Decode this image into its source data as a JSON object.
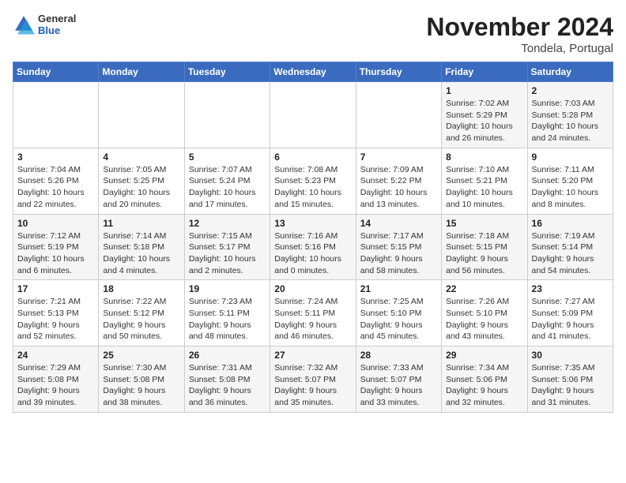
{
  "logo": {
    "general": "General",
    "blue": "Blue"
  },
  "title": "November 2024",
  "subtitle": "Tondela, Portugal",
  "days_of_week": [
    "Sunday",
    "Monday",
    "Tuesday",
    "Wednesday",
    "Thursday",
    "Friday",
    "Saturday"
  ],
  "weeks": [
    [
      {
        "day": "",
        "info": ""
      },
      {
        "day": "",
        "info": ""
      },
      {
        "day": "",
        "info": ""
      },
      {
        "day": "",
        "info": ""
      },
      {
        "day": "",
        "info": ""
      },
      {
        "day": "1",
        "info": "Sunrise: 7:02 AM\nSunset: 5:29 PM\nDaylight: 10 hours and 26 minutes."
      },
      {
        "day": "2",
        "info": "Sunrise: 7:03 AM\nSunset: 5:28 PM\nDaylight: 10 hours and 24 minutes."
      }
    ],
    [
      {
        "day": "3",
        "info": "Sunrise: 7:04 AM\nSunset: 5:26 PM\nDaylight: 10 hours and 22 minutes."
      },
      {
        "day": "4",
        "info": "Sunrise: 7:05 AM\nSunset: 5:25 PM\nDaylight: 10 hours and 20 minutes."
      },
      {
        "day": "5",
        "info": "Sunrise: 7:07 AM\nSunset: 5:24 PM\nDaylight: 10 hours and 17 minutes."
      },
      {
        "day": "6",
        "info": "Sunrise: 7:08 AM\nSunset: 5:23 PM\nDaylight: 10 hours and 15 minutes."
      },
      {
        "day": "7",
        "info": "Sunrise: 7:09 AM\nSunset: 5:22 PM\nDaylight: 10 hours and 13 minutes."
      },
      {
        "day": "8",
        "info": "Sunrise: 7:10 AM\nSunset: 5:21 PM\nDaylight: 10 hours and 10 minutes."
      },
      {
        "day": "9",
        "info": "Sunrise: 7:11 AM\nSunset: 5:20 PM\nDaylight: 10 hours and 8 minutes."
      }
    ],
    [
      {
        "day": "10",
        "info": "Sunrise: 7:12 AM\nSunset: 5:19 PM\nDaylight: 10 hours and 6 minutes."
      },
      {
        "day": "11",
        "info": "Sunrise: 7:14 AM\nSunset: 5:18 PM\nDaylight: 10 hours and 4 minutes."
      },
      {
        "day": "12",
        "info": "Sunrise: 7:15 AM\nSunset: 5:17 PM\nDaylight: 10 hours and 2 minutes."
      },
      {
        "day": "13",
        "info": "Sunrise: 7:16 AM\nSunset: 5:16 PM\nDaylight: 10 hours and 0 minutes."
      },
      {
        "day": "14",
        "info": "Sunrise: 7:17 AM\nSunset: 5:15 PM\nDaylight: 9 hours and 58 minutes."
      },
      {
        "day": "15",
        "info": "Sunrise: 7:18 AM\nSunset: 5:15 PM\nDaylight: 9 hours and 56 minutes."
      },
      {
        "day": "16",
        "info": "Sunrise: 7:19 AM\nSunset: 5:14 PM\nDaylight: 9 hours and 54 minutes."
      }
    ],
    [
      {
        "day": "17",
        "info": "Sunrise: 7:21 AM\nSunset: 5:13 PM\nDaylight: 9 hours and 52 minutes."
      },
      {
        "day": "18",
        "info": "Sunrise: 7:22 AM\nSunset: 5:12 PM\nDaylight: 9 hours and 50 minutes."
      },
      {
        "day": "19",
        "info": "Sunrise: 7:23 AM\nSunset: 5:11 PM\nDaylight: 9 hours and 48 minutes."
      },
      {
        "day": "20",
        "info": "Sunrise: 7:24 AM\nSunset: 5:11 PM\nDaylight: 9 hours and 46 minutes."
      },
      {
        "day": "21",
        "info": "Sunrise: 7:25 AM\nSunset: 5:10 PM\nDaylight: 9 hours and 45 minutes."
      },
      {
        "day": "22",
        "info": "Sunrise: 7:26 AM\nSunset: 5:10 PM\nDaylight: 9 hours and 43 minutes."
      },
      {
        "day": "23",
        "info": "Sunrise: 7:27 AM\nSunset: 5:09 PM\nDaylight: 9 hours and 41 minutes."
      }
    ],
    [
      {
        "day": "24",
        "info": "Sunrise: 7:29 AM\nSunset: 5:08 PM\nDaylight: 9 hours and 39 minutes."
      },
      {
        "day": "25",
        "info": "Sunrise: 7:30 AM\nSunset: 5:08 PM\nDaylight: 9 hours and 38 minutes."
      },
      {
        "day": "26",
        "info": "Sunrise: 7:31 AM\nSunset: 5:08 PM\nDaylight: 9 hours and 36 minutes."
      },
      {
        "day": "27",
        "info": "Sunrise: 7:32 AM\nSunset: 5:07 PM\nDaylight: 9 hours and 35 minutes."
      },
      {
        "day": "28",
        "info": "Sunrise: 7:33 AM\nSunset: 5:07 PM\nDaylight: 9 hours and 33 minutes."
      },
      {
        "day": "29",
        "info": "Sunrise: 7:34 AM\nSunset: 5:06 PM\nDaylight: 9 hours and 32 minutes."
      },
      {
        "day": "30",
        "info": "Sunrise: 7:35 AM\nSunset: 5:06 PM\nDaylight: 9 hours and 31 minutes."
      }
    ]
  ]
}
